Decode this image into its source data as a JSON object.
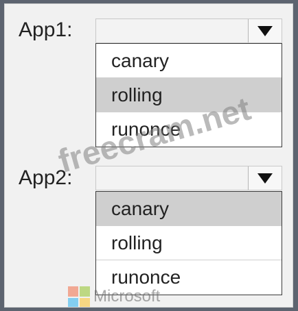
{
  "app1": {
    "label": "App1:",
    "selected_value": "",
    "options": [
      "canary",
      "rolling",
      "runonce"
    ],
    "highlighted_option": "rolling"
  },
  "app2": {
    "label": "App2:",
    "selected_value": "",
    "options": [
      "canary",
      "rolling",
      "runonce"
    ],
    "highlighted_option": "canary"
  },
  "watermark": "freecram.net",
  "brand": {
    "text": "Microsoft",
    "logo_colors": [
      "#f25022",
      "#7fba00",
      "#00a4ef",
      "#ffb900"
    ]
  },
  "colors": {
    "highlight": "#cfcfcf",
    "frame": "#5d6470"
  },
  "icons": {
    "dropdown_arrow": "chevron-down-icon"
  }
}
